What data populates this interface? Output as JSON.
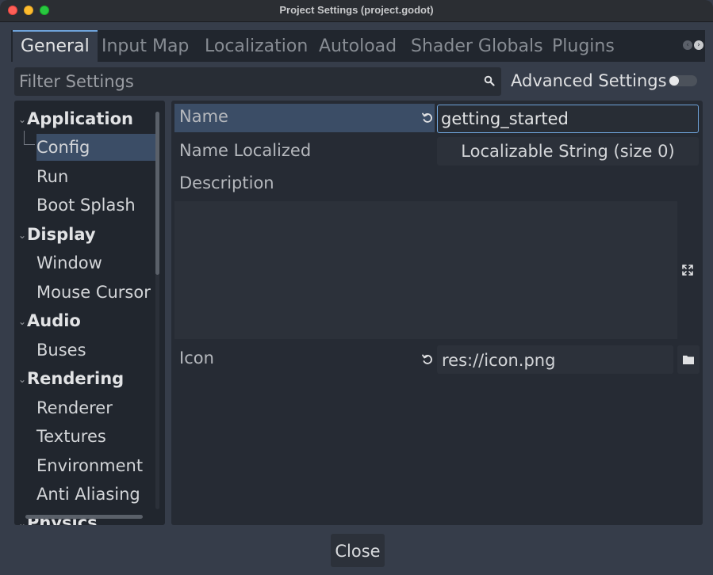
{
  "window": {
    "title": "Project Settings (project.godot)"
  },
  "tabs": [
    {
      "label": "General",
      "active": true
    },
    {
      "label": "Input Map",
      "active": false
    },
    {
      "label": "Localization",
      "active": false
    },
    {
      "label": "Autoload",
      "active": false
    },
    {
      "label": "Shader Globals",
      "active": false
    },
    {
      "label": "Plugins",
      "active": false
    }
  ],
  "filter": {
    "placeholder": "Filter Settings",
    "value": ""
  },
  "advanced": {
    "label": "Advanced Settings",
    "enabled": false
  },
  "tree": {
    "sections": [
      {
        "label": "Application",
        "items": [
          "Config",
          "Run",
          "Boot Splash"
        ]
      },
      {
        "label": "Display",
        "items": [
          "Window",
          "Mouse Cursor"
        ]
      },
      {
        "label": "Audio",
        "items": [
          "Buses"
        ]
      },
      {
        "label": "Rendering",
        "items": [
          "Renderer",
          "Textures",
          "Environment",
          "Anti Aliasing"
        ]
      },
      {
        "label": "Physics",
        "items": []
      }
    ],
    "selected": "Config"
  },
  "properties": {
    "name": {
      "label": "Name",
      "value": "getting_started"
    },
    "name_localized": {
      "label": "Name Localized",
      "button": "Localizable String (size 0)"
    },
    "description": {
      "label": "Description",
      "value": ""
    },
    "icon": {
      "label": "Icon",
      "value": "res://icon.png"
    }
  },
  "footer": {
    "close_label": "Close"
  }
}
